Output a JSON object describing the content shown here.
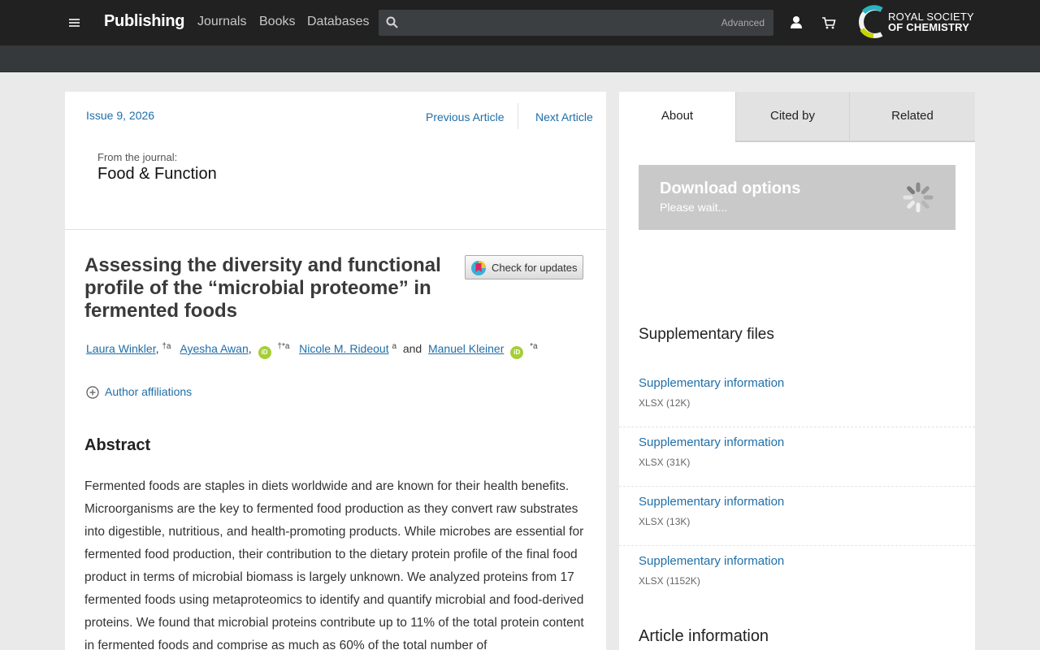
{
  "header": {
    "brand": "Publishing",
    "nav": [
      "Journals",
      "Books",
      "Databases"
    ],
    "search_placeholder": "",
    "advanced_label": "Advanced",
    "logo_line1": "ROYAL SOCIETY",
    "logo_line2": "OF CHEMISTRY"
  },
  "article_header": {
    "issue": "Issue 9, 2026",
    "previous": "Previous Article",
    "next": "Next Article",
    "from_journal": "From the journal:",
    "journal": "Food & Function"
  },
  "article": {
    "title": "Assessing the diversity and functional profile of the “microbial proteome” in fermented foods",
    "check_updates": "Check for updates",
    "authors": [
      {
        "name": "Laura Winkler",
        "marks": "†a"
      },
      {
        "name": "Ayesha Awan",
        "marks": "†*a"
      },
      {
        "name": "Nicole M. Rideout",
        "marks": "a"
      },
      {
        "name": "Manuel Kleiner",
        "marks": "*a"
      }
    ],
    "and_word": "and",
    "affiliations_label": "Author affiliations",
    "abstract_heading": "Abstract",
    "abstract_text": "Fermented foods are staples in diets worldwide and are known for their health benefits. Microorganisms are the key to fermented food production as they convert raw substrates into digestible, nutritious, and health-promoting products. While microbes are essential for fermented food production, their contribution to the dietary protein profile of the final food product in terms of microbial biomass is largely unknown. We analyzed proteins from 17 fermented foods using metaproteomics to identify and quantify microbial and food-derived proteins. We found that microbial proteins contribute up to 11% of the total protein content in fermented foods and comprise as much as 60% of the total number of"
  },
  "sidebar": {
    "tabs": [
      "About",
      "Cited by",
      "Related"
    ],
    "download_title": "Download options",
    "download_sub": "Please wait...",
    "supp_heading": "Supplementary files",
    "supp_files": [
      {
        "label": "Supplementary information",
        "meta": "XLSX (12K)"
      },
      {
        "label": "Supplementary information",
        "meta": "XLSX (31K)"
      },
      {
        "label": "Supplementary information",
        "meta": "XLSX (13K)"
      },
      {
        "label": "Supplementary information",
        "meta": "XLSX (1152K)"
      }
    ],
    "article_info_heading": "Article information"
  },
  "colors": {
    "topbar": "#212121",
    "link": "#1e6ea8",
    "orcid": "#a6ce39"
  }
}
